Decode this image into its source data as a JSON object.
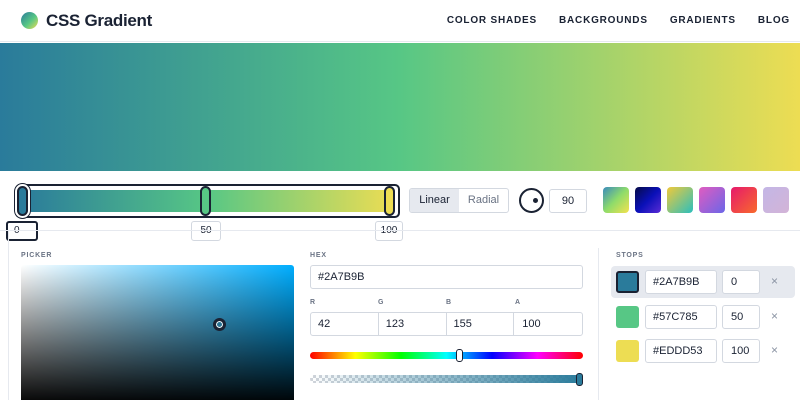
{
  "brand": {
    "name": "CSS Gradient"
  },
  "nav": {
    "items": [
      "COLOR SHADES",
      "BACKGROUNDS",
      "GRADIENTS",
      "BLOG"
    ]
  },
  "gradient": {
    "type_options": [
      "Linear",
      "Radial"
    ],
    "selected_type": "Linear",
    "angle": "90",
    "stops": [
      {
        "hex": "#2A7B9B",
        "position": "0"
      },
      {
        "hex": "#57C785",
        "position": "50"
      },
      {
        "hex": "#EDDD53",
        "position": "100"
      }
    ]
  },
  "presets": [
    {
      "name": "preset-1",
      "colors": [
        "#3a8bbd",
        "#8fdc6a",
        "#f4e24e"
      ]
    },
    {
      "name": "preset-2",
      "colors": [
        "#060b46",
        "#0a10b8",
        "#5a2bd6"
      ]
    },
    {
      "name": "preset-3",
      "colors": [
        "#f0c93a",
        "#2bbfbd"
      ]
    },
    {
      "name": "preset-4",
      "colors": [
        "#e05cc0",
        "#6b66e8"
      ]
    },
    {
      "name": "preset-5",
      "colors": [
        "#e6196b",
        "#f86a2c"
      ]
    },
    {
      "name": "preset-6",
      "colors": [
        "#c3b6e6",
        "#d3b4d7"
      ]
    }
  ],
  "picker": {
    "label": "PICKER",
    "hex_label": "HEX",
    "hex_value": "#2A7B9B",
    "rgba_labels": [
      "R",
      "G",
      "B",
      "A"
    ],
    "rgba_values": [
      "42",
      "123",
      "155",
      "100"
    ]
  },
  "stops_panel": {
    "label": "STOPS",
    "remove_symbol": "×"
  }
}
